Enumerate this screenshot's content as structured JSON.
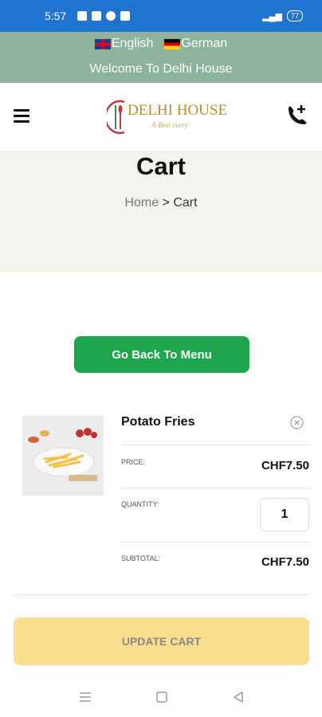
{
  "status_bar": {
    "time": "5:57",
    "battery": "77"
  },
  "topbar": {
    "languages": [
      {
        "label": "English"
      },
      {
        "label": "German"
      }
    ],
    "welcome": "Welcome To Delhi House"
  },
  "header": {
    "logo_text": "DELHI HOUSE",
    "logo_sub": "A-Best curry"
  },
  "banner": {
    "title": "Cart",
    "crumb_home": "Home",
    "crumb_sep": ">",
    "crumb_current": "Cart"
  },
  "cart": {
    "back_label": "Go Back To Menu",
    "item": {
      "name": "Potato Fries",
      "price_label": "PRICE:",
      "price_value": "CHF7.50",
      "quantity_label": "QUANTITY:",
      "quantity_value": "1",
      "subtotal_label": "SUBTOTAL:",
      "subtotal_value": "CHF7.50"
    },
    "update_label": "UPDATE CART"
  },
  "colors": {
    "status_bar": "#1f74cf",
    "topbar": "#8db39d",
    "banner": "#f5f3ee",
    "primary_button": "#1ea54d",
    "update_button": "#fbdd8f",
    "logo_gold": "#b8912f"
  },
  "icons": [
    "menu-icon",
    "phone-icon",
    "remove-icon",
    "nav-menu-icon",
    "nav-home-icon",
    "nav-back-icon"
  ]
}
